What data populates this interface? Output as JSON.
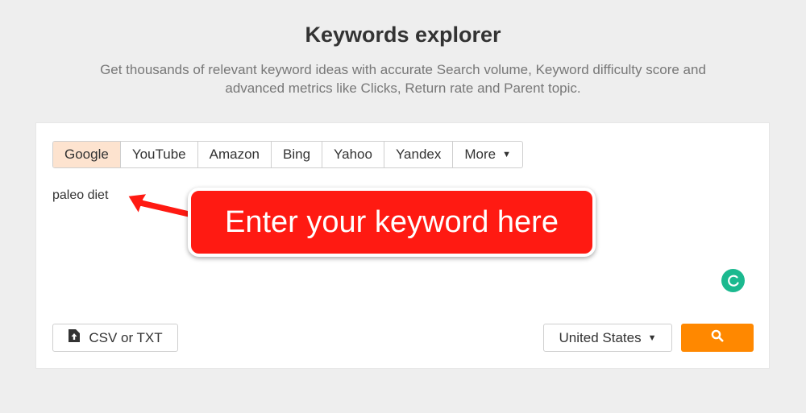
{
  "header": {
    "title": "Keywords explorer",
    "subtitle": "Get thousands of relevant keyword ideas with accurate Search volume, Keyword difficulty score and advanced metrics like Clicks, Return rate and Parent topic."
  },
  "engines": {
    "tabs": [
      {
        "label": "Google",
        "active": true
      },
      {
        "label": "YouTube",
        "active": false
      },
      {
        "label": "Amazon",
        "active": false
      },
      {
        "label": "Bing",
        "active": false
      },
      {
        "label": "Yahoo",
        "active": false
      },
      {
        "label": "Yandex",
        "active": false
      }
    ],
    "more_label": "More"
  },
  "keyword_input": {
    "value": "paleo diet"
  },
  "upload": {
    "label": "CSV or TXT",
    "icon": "file-upload-icon"
  },
  "country": {
    "selected": "United States"
  },
  "search": {
    "icon": "search-icon"
  },
  "annotation": {
    "text": "Enter your keyword here"
  },
  "colors": {
    "accent_orange": "#ff8800",
    "active_tab_bg": "#fde3cf",
    "callout_red": "#ff1a12",
    "grammarly_green": "#1bb98f"
  }
}
